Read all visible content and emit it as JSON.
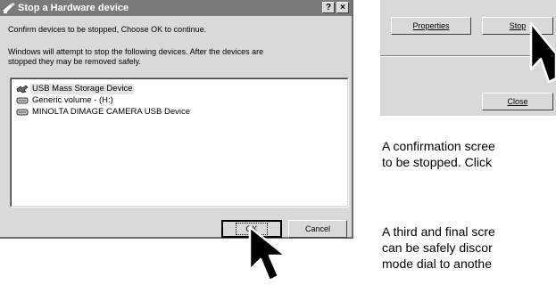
{
  "dialog": {
    "title": "Stop a Hardware device",
    "help_label": "?",
    "close_label": "×",
    "message1": "Confirm devices to be stopped, Choose OK to continue.",
    "message2_line1": "Windows will attempt to stop the following devices. After the devices are",
    "message2_line2": "stopped they may be removed safely.",
    "devices": [
      {
        "label": "USB Mass Storage Device",
        "icon": "usb-device-icon"
      },
      {
        "label": "Generic volume - (H:)",
        "icon": "drive-icon"
      },
      {
        "label": "MINOLTA DIMAGE  CAMERA USB Device",
        "icon": "drive-icon"
      }
    ],
    "ok_label": "OK",
    "cancel_label": "Cancel"
  },
  "side_panel": {
    "properties_label": "Properties",
    "stop_label": "Stop",
    "close_label": "Close"
  },
  "captions": {
    "line1": "A confirmation scree",
    "line2": "to be stopped. Click",
    "line3": "A third and final scre",
    "line4": "can be safely discor",
    "line5": "mode dial to anothe"
  }
}
